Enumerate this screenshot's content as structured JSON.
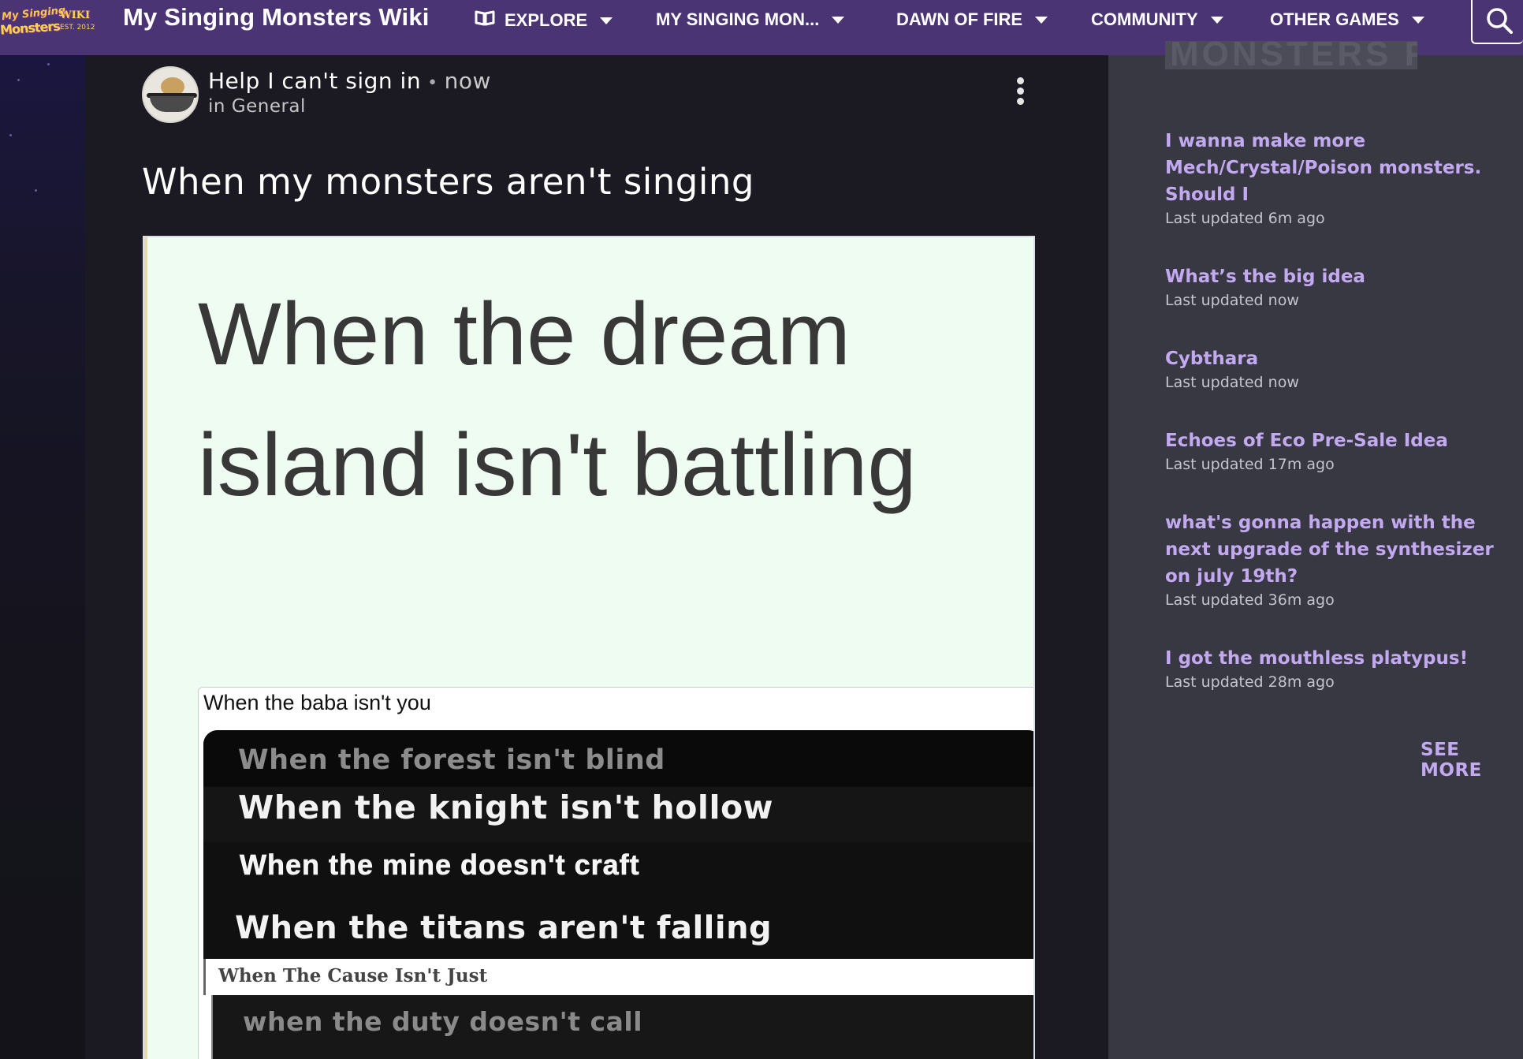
{
  "nav": {
    "logo": {
      "line1": "My Singing",
      "line2": "Monsters",
      "line3": "WIKI",
      "line4": "EST. 2012"
    },
    "site_title": "My Singing Monsters Wiki",
    "items": [
      {
        "label": "EXPLORE",
        "icon": "explore-icon"
      },
      {
        "label": "MY SINGING MON..."
      },
      {
        "label": "DAWN OF FIRE"
      },
      {
        "label": "COMMUNITY"
      },
      {
        "label": "OTHER GAMES"
      }
    ],
    "search_icon": "search-icon"
  },
  "post": {
    "title": "Help I can't sign in",
    "separator": "•",
    "time": "now",
    "category": "in General",
    "heading": "When my monsters aren't singing",
    "meme": {
      "big_text": "When the dream island isn't battling",
      "caption": "When the baba isn't you",
      "lines": [
        "When the forest isn't blind",
        "When the knight isn't hollow",
        "When the mine doesn't craft",
        "When the titans aren't falling",
        "When The Cause Isn't Just",
        "when the duty doesn't call"
      ]
    }
  },
  "rail": {
    "feed_heading": "MONSTERS FEED",
    "items": [
      {
        "title": "I wanna make more Mech/Crystal/Poison monsters. Should I",
        "meta": "Last updated 6m ago"
      },
      {
        "title": "What’s the big idea",
        "meta": "Last updated now"
      },
      {
        "title": "Cybthara",
        "meta": "Last updated now"
      },
      {
        "title": "Echoes of Eco Pre-Sale Idea",
        "meta": "Last updated 17m ago"
      },
      {
        "title": "what's gonna happen with the next upgrade of the synthesizer on july 19th?",
        "meta": "Last updated 36m ago"
      },
      {
        "title": "I got the mouthless platypus!",
        "meta": "Last updated 28m ago"
      }
    ],
    "see_more": "SEE MORE"
  },
  "colors": {
    "nav_bg": "#4a3474",
    "accent": "#c3a9f0",
    "rail_bg": "#383843",
    "page_bg": "#1b1a22"
  }
}
